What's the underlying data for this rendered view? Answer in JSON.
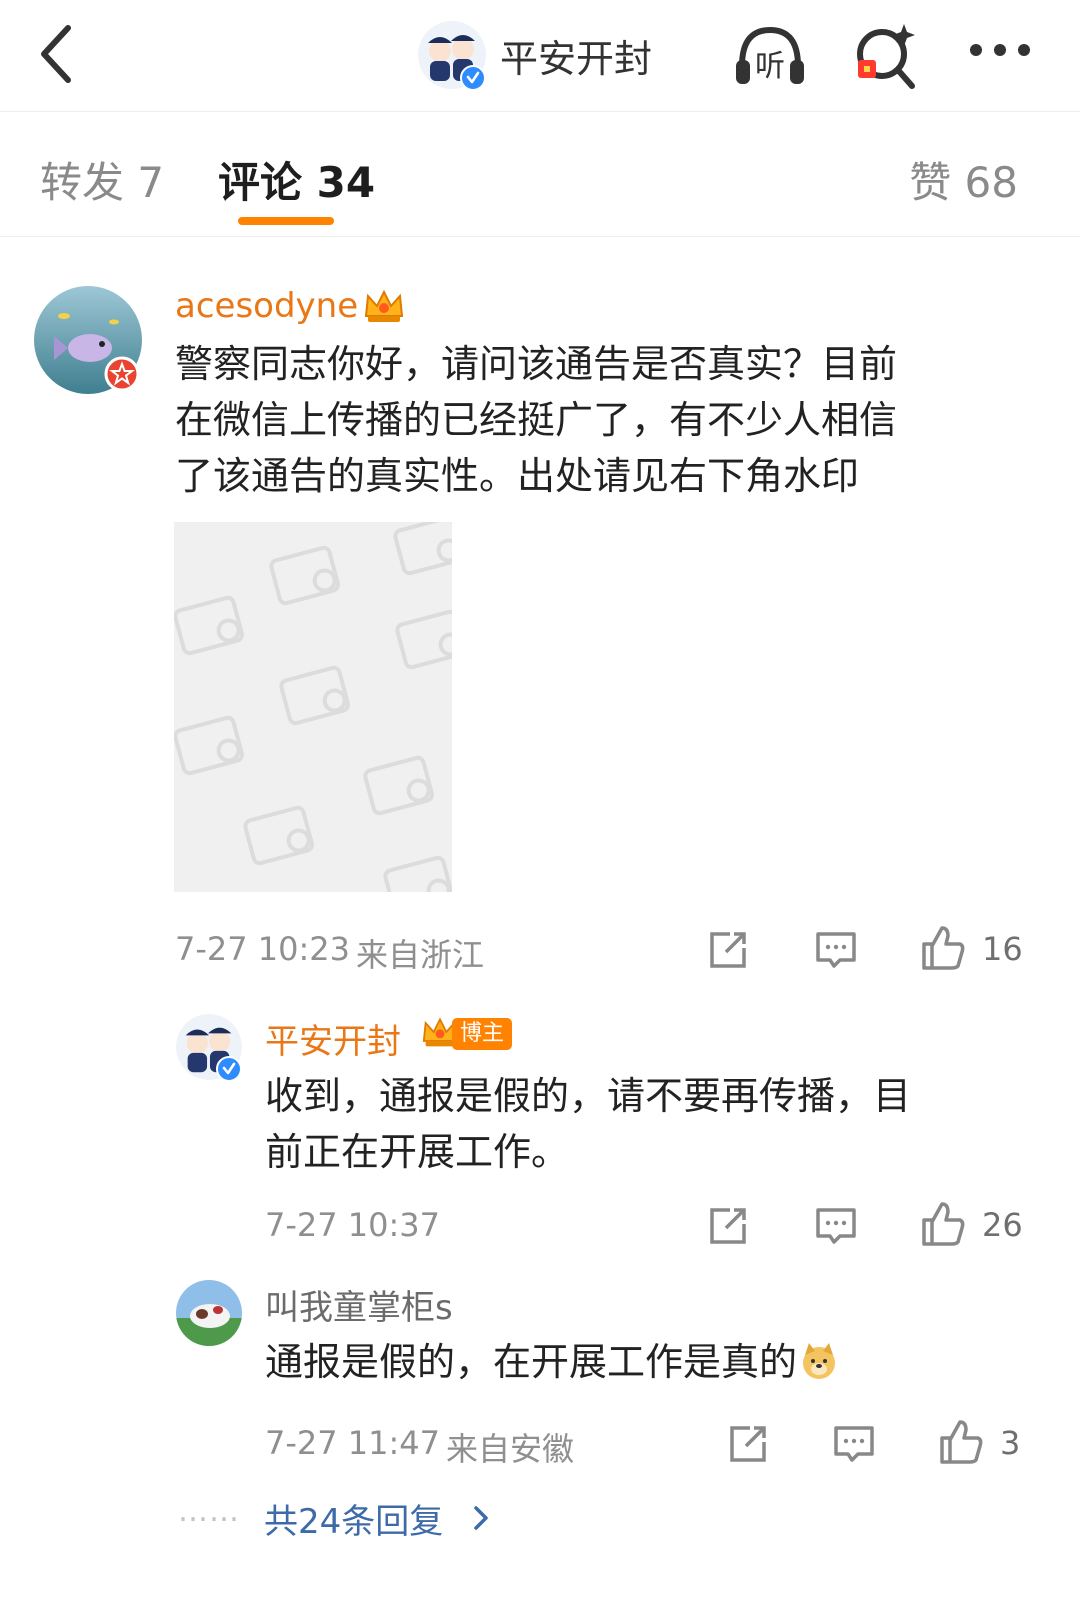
{
  "header": {
    "title": "平安开封",
    "listen_label": "听"
  },
  "tabs": {
    "repost": "转发 7",
    "comment": "评论 34",
    "like": "赞 68"
  },
  "comments": [
    {
      "username": "acesodyne",
      "text": [
        "警察同志你好，请问该通告是否真实？目前",
        "在微信上传播的已经挺广了，有不少人相信",
        "了该通告的真实性。出处请见右下角水印"
      ],
      "time": "7-27 10:23",
      "location": "来自浙江",
      "likes": "16"
    },
    {
      "username": "平安开封",
      "badge": "博主",
      "text": [
        "收到，通报是假的，请不要再传播，目",
        "前正在开展工作。"
      ],
      "time": "7-27 10:37",
      "likes": "26"
    },
    {
      "username": "叫我童掌柜s",
      "text": "通报是假的，在开展工作是真的",
      "time": "7-27 11:47",
      "location": "来自安徽",
      "likes": "3"
    }
  ],
  "more_replies": {
    "dots": "……",
    "label": "共24条回复"
  },
  "colors": {
    "accent_orange": "#ff8200",
    "username_orange": "#e97716",
    "link_blue": "#3d6aa8",
    "meta_gray": "#8f8f8f"
  }
}
